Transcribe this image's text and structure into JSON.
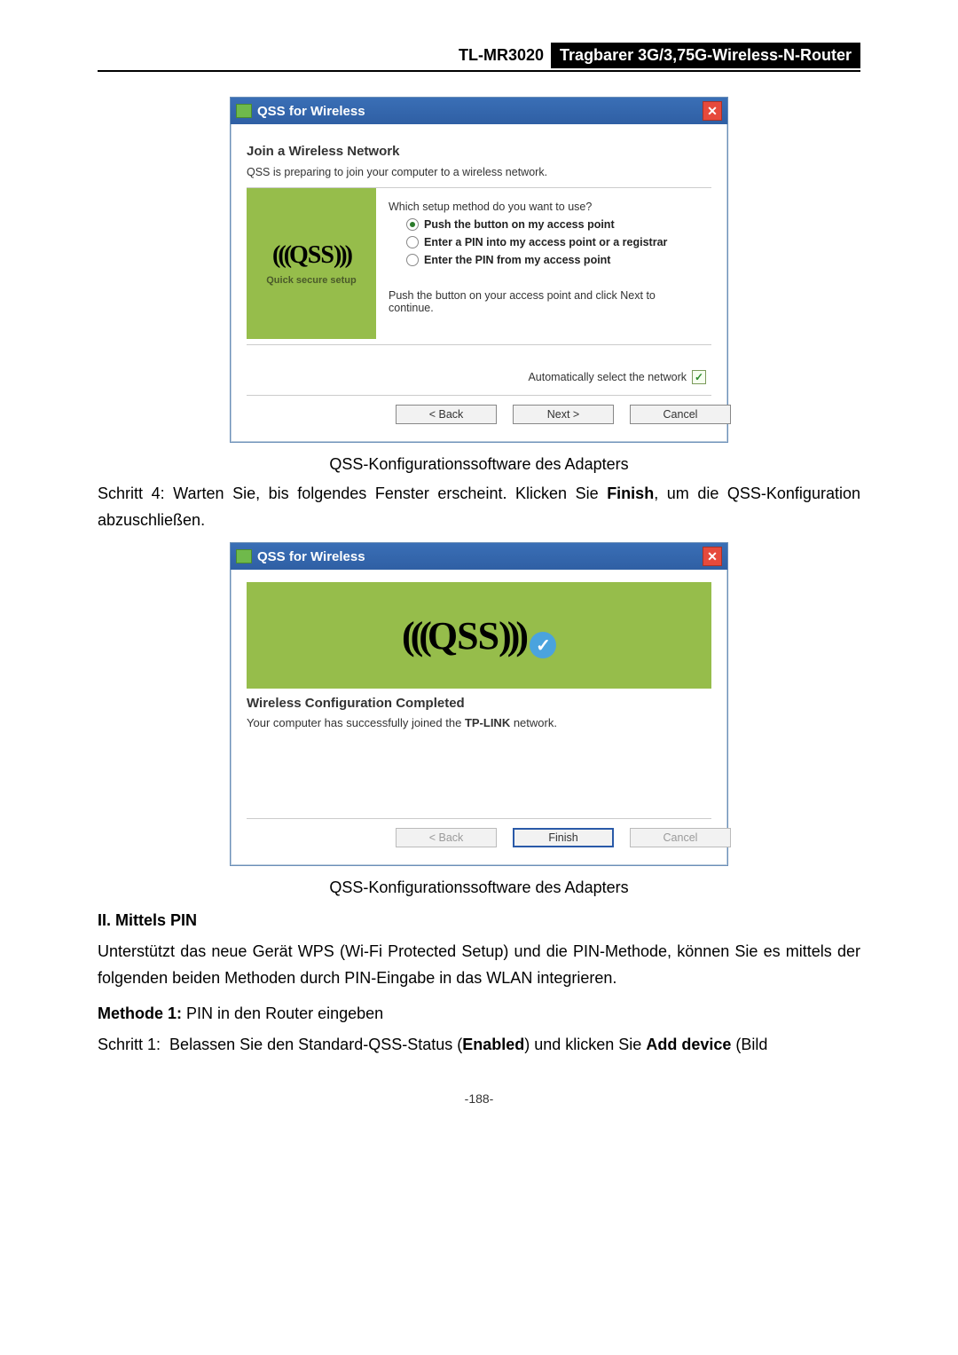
{
  "header": {
    "model": "TL-MR3020",
    "title": "Tragbarer 3G/3,75G-Wireless-N-Router"
  },
  "dialog1": {
    "title": "QSS for Wireless",
    "heading": "Join a Wireless Network",
    "subtext": "QSS is preparing to join your computer to a wireless network.",
    "sidebar_caption": "Quick secure setup",
    "question": "Which setup method do you want to use?",
    "opt1": "Push the button on my access point",
    "opt2": "Enter a PIN into my access point or a registrar",
    "opt3": "Enter the PIN from my access point",
    "instruction": "Push the button on your access point and click Next to continue.",
    "auto_label": "Automatically select the network",
    "back": "< Back",
    "next": "Next >",
    "cancel": "Cancel"
  },
  "caption1": "QSS-Konfigurationssoftware des Adapters",
  "step4": {
    "prefix": "Schritt 4:",
    "text_a": "Warten Sie, bis folgendes Fenster erscheint. Klicken Sie ",
    "finish": "Finish",
    "text_b": ", um die QSS-Konfiguration abzuschließen."
  },
  "dialog2": {
    "title": "QSS for Wireless",
    "heading": "Wireless Configuration Completed",
    "body_a": "Your computer has successfully joined the ",
    "network": "TP-LINK",
    "body_b": " network.",
    "back": "< Back",
    "finish": "Finish",
    "cancel": "Cancel"
  },
  "caption2": "QSS-Konfigurationssoftware des Adapters",
  "section2": "II.   Mittels PIN",
  "para2": "Unterstützt das neue Gerät WPS (Wi-Fi Protected Setup) und die PIN-Methode, können Sie es mittels der folgenden beiden Methoden durch PIN-Eingabe in das WLAN integrieren.",
  "method1": {
    "label": "Methode 1:",
    "text": " PIN in den Router eingeben"
  },
  "step1": {
    "prefix": "Schritt 1:",
    "text_a": "Belassen Sie den Standard-QSS-Status (",
    "enabled": "Enabled",
    "text_b": ") und klicken Sie ",
    "add": "Add device",
    "text_c": " (Bild"
  },
  "page_number": "-188-"
}
